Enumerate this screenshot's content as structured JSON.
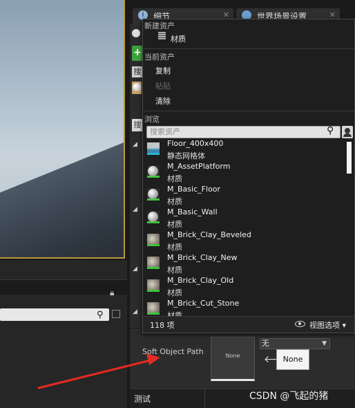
{
  "tabs": [
    {
      "label": "细节",
      "icon": "info-icon"
    },
    {
      "label": "世界场景设置",
      "icon": "globe-icon"
    }
  ],
  "popup": {
    "sections": {
      "new_asset": "新建资产",
      "current_asset": "当前资产",
      "browse": "浏览"
    },
    "new_items": [
      {
        "label": "材质",
        "icon": "material-icon"
      }
    ],
    "current_items": [
      {
        "label": "复制",
        "enabled": true
      },
      {
        "label": "粘贴",
        "enabled": false
      },
      {
        "label": "清除",
        "enabled": true
      }
    ],
    "search_placeholder": "搜索资产",
    "assets": [
      {
        "name": "Floor_400x400",
        "type": "静态网格体",
        "thumb": "mesh"
      },
      {
        "name": "M_AssetPlatform",
        "type": "材质",
        "thumb": "sphere"
      },
      {
        "name": "M_Basic_Floor",
        "type": "材质",
        "thumb": "sphere"
      },
      {
        "name": "M_Basic_Wall",
        "type": "材质",
        "thumb": "sphere"
      },
      {
        "name": "M_Brick_Clay_Beveled",
        "type": "材质",
        "thumb": "rock"
      },
      {
        "name": "M_Brick_Clay_New",
        "type": "材质",
        "thumb": "rock"
      },
      {
        "name": "M_Brick_Clay_Old",
        "type": "材质",
        "thumb": "rock"
      },
      {
        "name": "M_Brick_Cut_Stone",
        "type": "材质",
        "thumb": "rock"
      }
    ],
    "item_count": "118 项",
    "view_options": "视图选项"
  },
  "property": {
    "label": "Soft Object Path",
    "thumb_label": "None",
    "combo_value": "无",
    "none_button": "None"
  },
  "section_test": "测试",
  "partial_strip": {
    "add_glyph": "+",
    "search_char_1": "搜",
    "search_char_2": "搜"
  },
  "watermark": "CSDN @飞起的猪"
}
